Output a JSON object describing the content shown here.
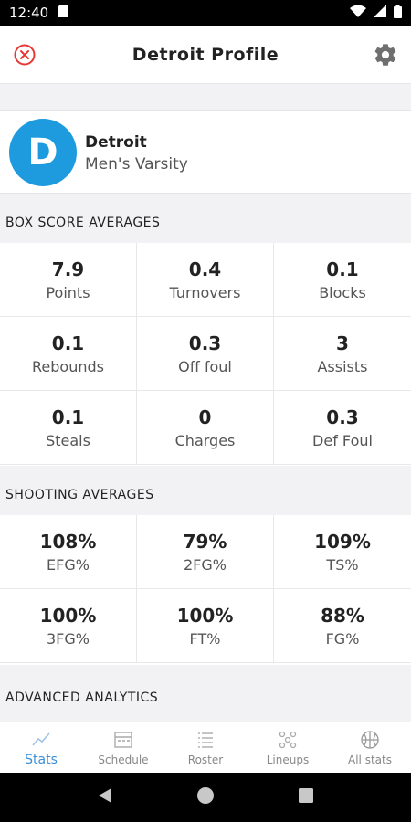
{
  "status_bar": {
    "time": "12:40"
  },
  "header": {
    "title": "Detroit Profile"
  },
  "team": {
    "initial": "D",
    "name": "Detroit",
    "subtitle": "Men's Varsity"
  },
  "box_score": {
    "title": "BOX SCORE AVERAGES",
    "stats": [
      {
        "value": "7.9",
        "label": "Points"
      },
      {
        "value": "0.4",
        "label": "Turnovers"
      },
      {
        "value": "0.1",
        "label": "Blocks"
      },
      {
        "value": "0.1",
        "label": "Rebounds"
      },
      {
        "value": "0.3",
        "label": "Off foul"
      },
      {
        "value": "3",
        "label": "Assists"
      },
      {
        "value": "0.1",
        "label": "Steals"
      },
      {
        "value": "0",
        "label": "Charges"
      },
      {
        "value": "0.3",
        "label": "Def Foul"
      }
    ]
  },
  "shooting": {
    "title": "SHOOTING AVERAGES",
    "stats": [
      {
        "value": "108%",
        "label": "EFG%"
      },
      {
        "value": "79%",
        "label": "2FG%"
      },
      {
        "value": "109%",
        "label": "TS%"
      },
      {
        "value": "100%",
        "label": "3FG%"
      },
      {
        "value": "100%",
        "label": "FT%"
      },
      {
        "value": "88%",
        "label": "FG%"
      }
    ]
  },
  "advanced": {
    "title": "ADVANCED ANALYTICS"
  },
  "bottom_nav": {
    "items": [
      {
        "label": "Stats",
        "icon": "line-chart-icon",
        "active": true
      },
      {
        "label": "Schedule",
        "icon": "calendar-icon",
        "active": false
      },
      {
        "label": "Roster",
        "icon": "list-icon",
        "active": false
      },
      {
        "label": "Lineups",
        "icon": "lineup-icon",
        "active": false
      },
      {
        "label": "All stats",
        "icon": "basketball-icon",
        "active": false
      }
    ]
  },
  "colors": {
    "accent": "#1e9bdf",
    "close": "#e53935",
    "nav_active": "#3b8fd6"
  }
}
